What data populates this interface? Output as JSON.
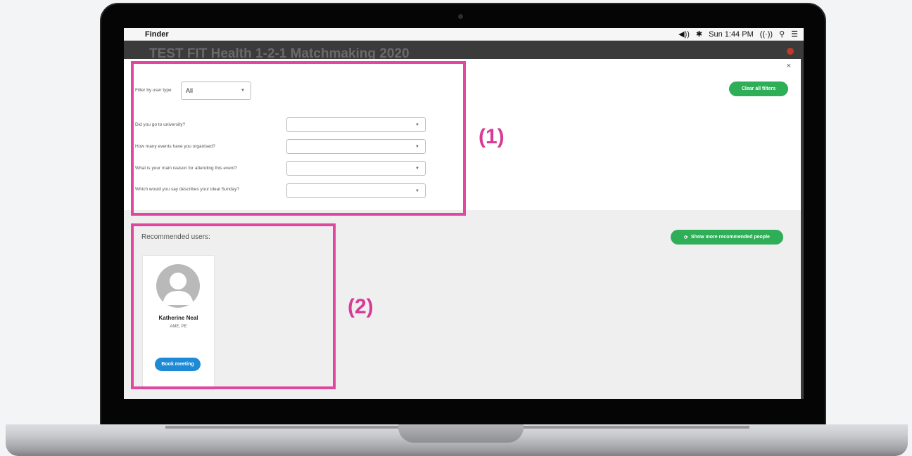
{
  "menubar": {
    "apple": "",
    "app_name": "Finder",
    "volume": "◀))",
    "bluetooth": "✱",
    "clock": "Sun 1:44 PM",
    "wifi": "((·))",
    "search": "⚲",
    "list": "☰"
  },
  "background": {
    "title": "TEST FIT Health 1-2-1 Matchmaking 2020"
  },
  "modal": {
    "close": "×",
    "filter_user_type_label": "Filter by user type",
    "filter_user_type_value": "All",
    "clear_filters": "Clear all filters",
    "questions": [
      "Did you go to university?",
      "How many events have you organised?",
      "What is your main reason for attending this event?",
      "Which would you say describes your ideal Sunday?"
    ],
    "recommended_title": "Recommended users:",
    "show_more": "Show more recommended people",
    "user": {
      "name": "Katherine Neal",
      "org": "AME, PE",
      "book": "Book meeting"
    }
  },
  "annotations": {
    "label1": "(1)",
    "label2": "(2)",
    "color": "#e0479e"
  },
  "colors": {
    "green": "#2eae57",
    "blue": "#1e8ad6"
  }
}
